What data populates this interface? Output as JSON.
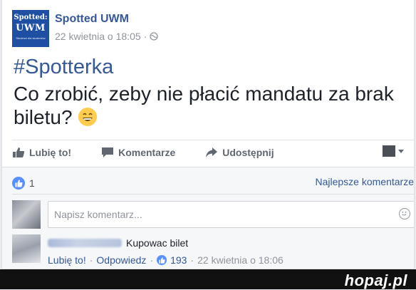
{
  "post": {
    "page_name": "Spotted UWM",
    "avatar_line1": "Spotted:",
    "avatar_line2": "UWM",
    "avatar_line3": "Studenci dla studentów",
    "date": "22 kwietnia o 18:05",
    "date_separator": "·",
    "privacy_icon": "globe-icon",
    "hashtag": "#Spotterka",
    "text": "Co zrobić, zeby nie płacić mandatu za brak biletu?",
    "emoji": "grinning-face-emoji"
  },
  "actions": {
    "like_label": "Lubię to!",
    "comment_label": "Komentarze",
    "share_label": "Udostępnij"
  },
  "reactions": {
    "count": "1",
    "best_comments_label": "Najlepsze komentarze"
  },
  "comment_box": {
    "placeholder": "Napisz komentarz..."
  },
  "comment": {
    "text": "Kupowac bilet",
    "like_label": "Lubię to!",
    "separator": "·",
    "reply_label": "Odpowiedz",
    "likes": "193",
    "date": "22 kwietnia o 18:06"
  },
  "watermark": "hopaj.pl",
  "colors": {
    "link": "#365899",
    "like_blue": "#5890ff",
    "background": "#e9ebee"
  }
}
